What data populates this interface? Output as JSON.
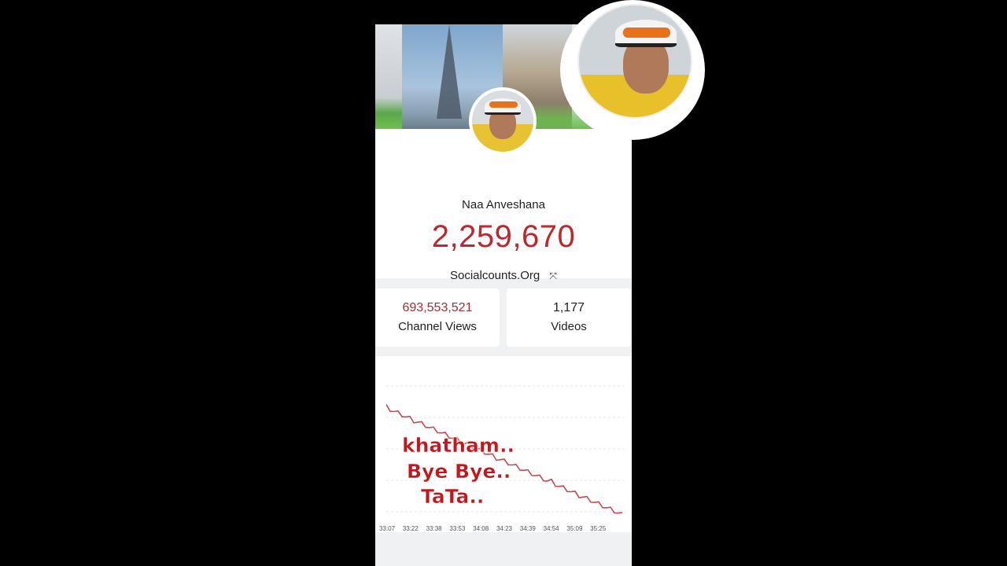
{
  "profile": {
    "channel_name": "Naa Anveshana",
    "subscriber_count": "2,259,670",
    "site_label": "Socialcounts.Org",
    "expand_icon": "expand-icon"
  },
  "stats": {
    "views_value": "693,553,521",
    "views_label": "Channel Views",
    "videos_value": "1,177",
    "videos_label": "Videos"
  },
  "overlay": {
    "line1": "khatham..",
    "line2": "Bye Bye..",
    "line3": "TaTa.."
  },
  "colors": {
    "accent": "#c0262d",
    "line": "#c94a4f"
  },
  "chart_data": {
    "type": "line",
    "x": [
      "33:07",
      "33:22",
      "33:38",
      "33:53",
      "34:08",
      "34:23",
      "34:39",
      "34:54",
      "35:09",
      "35:25"
    ],
    "trend": "decreasing",
    "grid": true
  }
}
